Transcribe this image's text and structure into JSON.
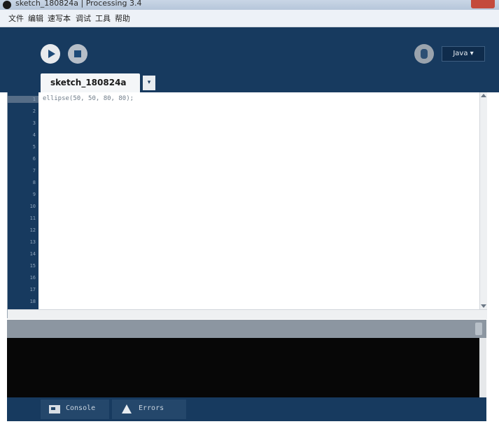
{
  "window": {
    "title": "sketch_180824a | Processing 3.4"
  },
  "menu": {
    "items": [
      "文件",
      "编辑",
      "速写本",
      "调试",
      "工具",
      "帮助"
    ]
  },
  "toolbar": {
    "mode_label": "Java ▾"
  },
  "tab": {
    "label": "sketch_180824a",
    "arrow": "▾"
  },
  "editor": {
    "line_numbers": [
      "1",
      "2",
      "3",
      "4",
      "5",
      "6",
      "7",
      "8",
      "9",
      "10",
      "11",
      "12",
      "13",
      "14",
      "15",
      "16",
      "17",
      "18"
    ],
    "code": [
      "ellipse(50, 50, 80, 80);"
    ]
  },
  "footer": {
    "console_label": "Console",
    "errors_label": "Errors"
  },
  "colors": {
    "toolbar_bg": "#173a5f",
    "console_bg": "#070707",
    "editor_bg": "#ffffff"
  }
}
